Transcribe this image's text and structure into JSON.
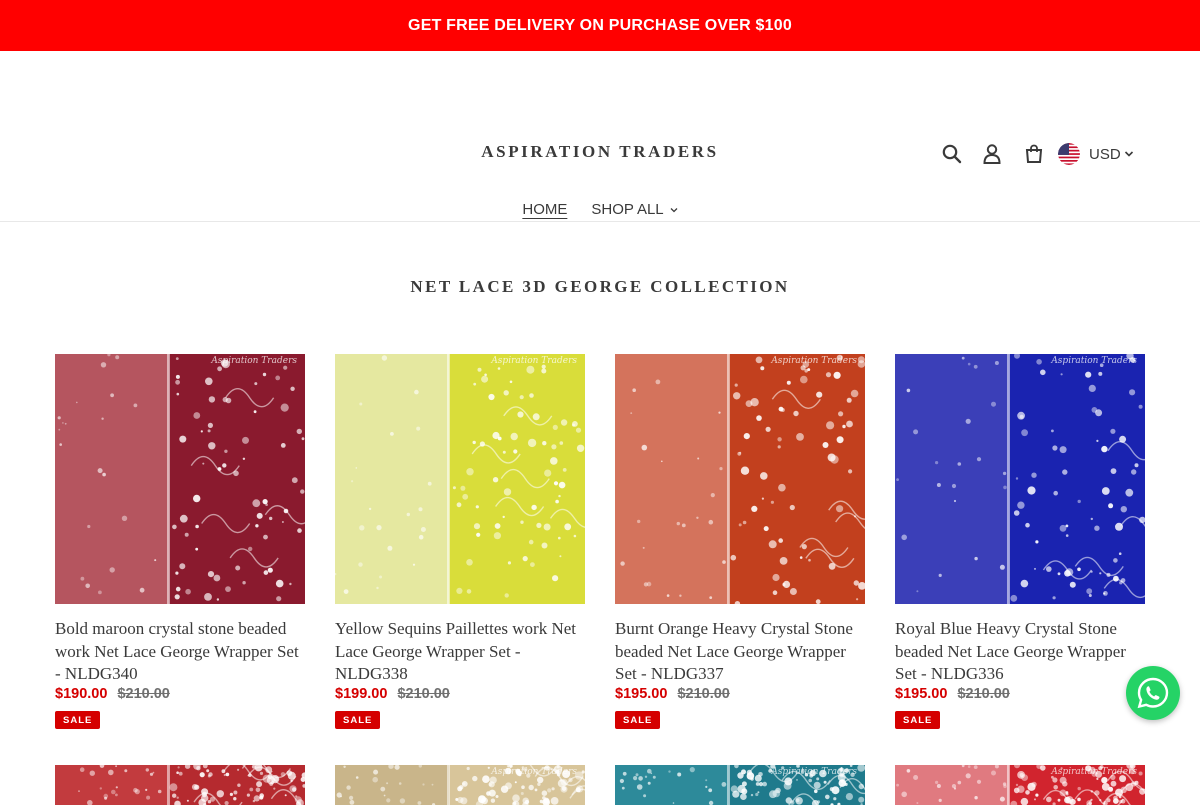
{
  "announcement": "GET FREE DELIVERY ON PURCHASE OVER $100",
  "header": {
    "logo": "ASPIRATION TRADERS",
    "currency": "USD",
    "icons": [
      "search-icon",
      "account-icon",
      "cart-icon",
      "us-flag-icon",
      "chevron-down-icon"
    ]
  },
  "nav": {
    "home": "HOME",
    "shop_all": "SHOP ALL"
  },
  "collection": {
    "title": "NET LACE 3D GEORGE COLLECTION"
  },
  "products": [
    {
      "title": "Bold maroon crystal stone beaded work Net Lace George Wrapper Set - NLDG340",
      "sale_price": "$190.00",
      "compare_price": "$210.00",
      "badge": "SALE",
      "watermark": "Aspiration Traders",
      "colors": {
        "left": "#b5555f",
        "right": "#8a1a2e"
      }
    },
    {
      "title": "Yellow Sequins Paillettes work Net Lace George Wrapper Set - NLDG338",
      "sale_price": "$199.00",
      "compare_price": "$210.00",
      "badge": "SALE",
      "watermark": "Aspiration Traders",
      "colors": {
        "left": "#e5e8a0",
        "right": "#d9dd3a"
      }
    },
    {
      "title": "Burnt Orange Heavy Crystal Stone beaded Net Lace George Wrapper Set - NLDG337",
      "sale_price": "$195.00",
      "compare_price": "$210.00",
      "badge": "SALE",
      "watermark": "Aspiration Traders",
      "colors": {
        "left": "#d4735c",
        "right": "#c2401e"
      }
    },
    {
      "title": "Royal Blue Heavy Crystal Stone beaded Net Lace George Wrapper Set - NLDG336",
      "sale_price": "$195.00",
      "compare_price": "$210.00",
      "badge": "SALE",
      "watermark": "Aspiration Traders",
      "colors": {
        "left": "#3b3fb8",
        "right": "#1a23b0"
      }
    }
  ],
  "products_row2": [
    {
      "watermark": "",
      "colors": {
        "left": "#c23b3e",
        "right": "#b52a2f"
      }
    },
    {
      "watermark": "Aspiration Traders",
      "colors": {
        "left": "#c9b58a",
        "right": "#d8c59a"
      }
    },
    {
      "watermark": "Aspiration Traders",
      "colors": {
        "left": "#2d8a9a",
        "right": "#1f7a8c"
      }
    },
    {
      "watermark": "Aspiration Traders",
      "colors": {
        "left": "#e07a80",
        "right": "#d1242e"
      }
    }
  ],
  "theme": {
    "announcement_bg": "#ff0000",
    "sale_color": "#d50000",
    "whatsapp_green": "#25d366"
  }
}
